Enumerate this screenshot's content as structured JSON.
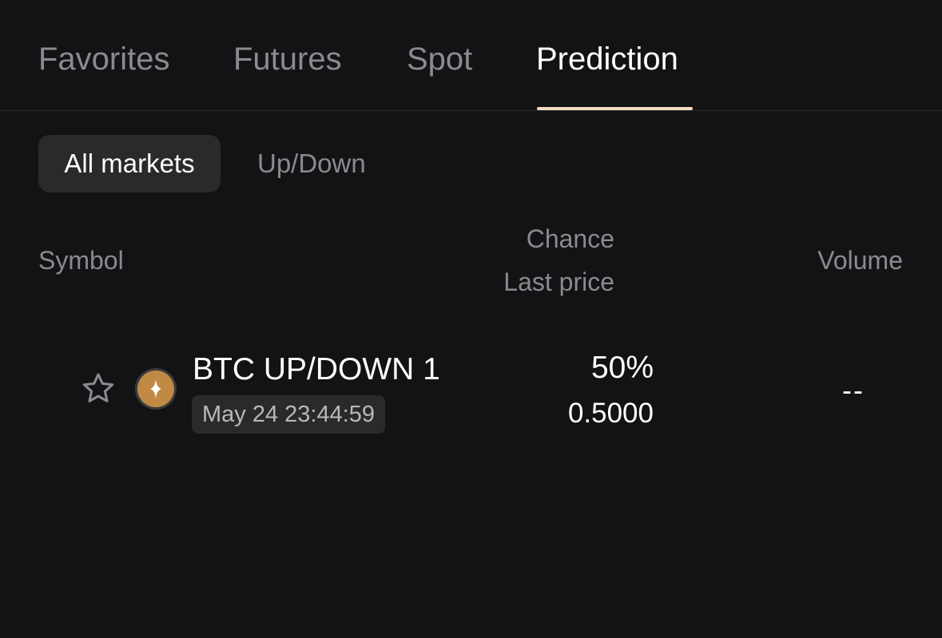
{
  "tabs": [
    {
      "label": "Favorites",
      "active": false
    },
    {
      "label": "Futures",
      "active": false
    },
    {
      "label": "Spot",
      "active": false
    },
    {
      "label": "Prediction",
      "active": true
    }
  ],
  "filters": {
    "active_label": "All markets",
    "inactive_label": "Up/Down"
  },
  "columns": {
    "symbol": "Symbol",
    "chance": "Chance",
    "last_price": "Last price",
    "volume": "Volume"
  },
  "markets": [
    {
      "name": "BTC UP/DOWN 1",
      "expiry": "May 24 23:44:59",
      "chance": "50%",
      "last_price": "0.5000",
      "volume": "--",
      "icon": "btc-sparkle-icon",
      "favorited": false
    }
  ],
  "colors": {
    "background": "#131315",
    "accent_underline": "#f3dcc0",
    "coin": "#c08a45",
    "muted_text": "#8b8b8f"
  }
}
